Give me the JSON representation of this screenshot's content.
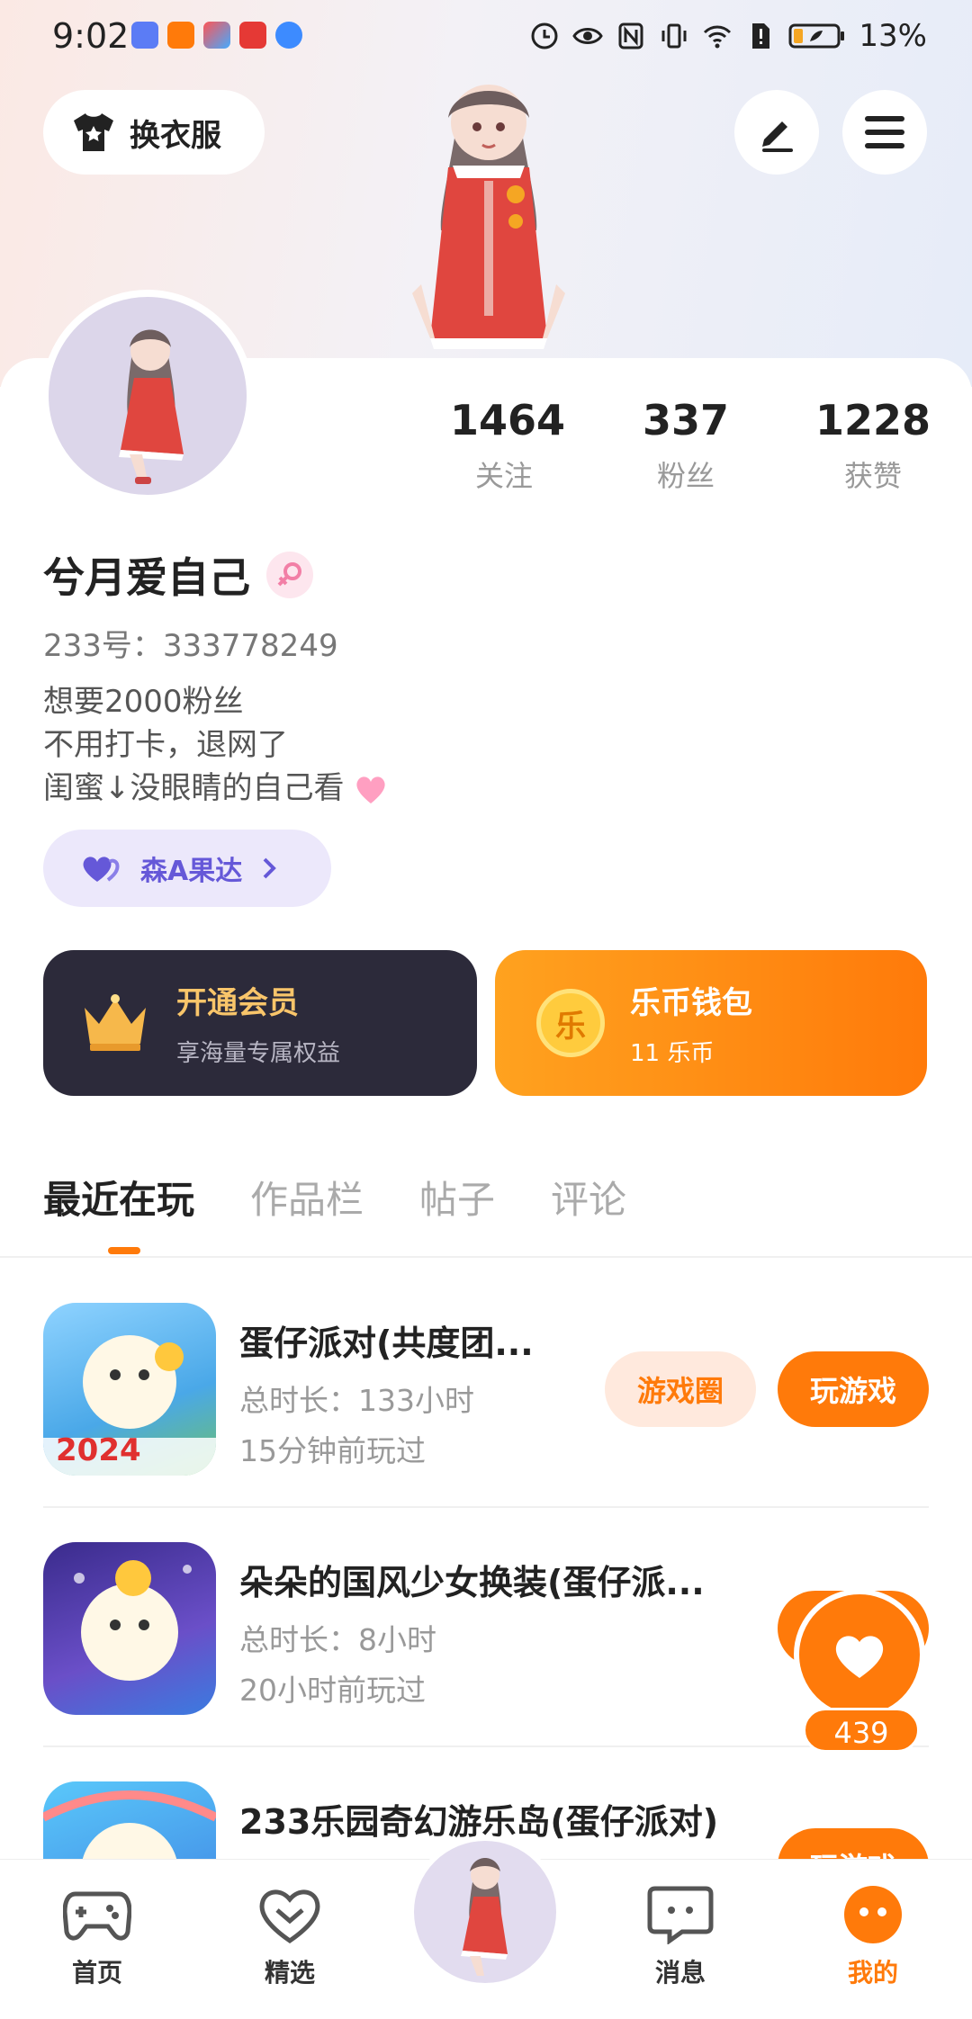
{
  "status_bar": {
    "time": "9:02",
    "battery": "13%"
  },
  "header": {
    "dress_button": "换衣服"
  },
  "stats": [
    {
      "num": "1464",
      "label": "关注"
    },
    {
      "num": "337",
      "label": "粉丝"
    },
    {
      "num": "1228",
      "label": "获赞"
    }
  ],
  "profile": {
    "name": "兮月爱自己",
    "uid": "233号：333778249",
    "bio": [
      "想要2000粉丝",
      "不用打卡，退网了",
      "闺蜜↓没眼睛的自己看"
    ],
    "tag": "森A果达"
  },
  "vip": {
    "title": "开通会员",
    "sub": "享海量专属权益"
  },
  "wallet": {
    "title": "乐币钱包",
    "sub": "11 乐币",
    "coin_char": "乐"
  },
  "tabs": [
    "最近在玩",
    "作品栏",
    "帖子",
    "评论"
  ],
  "games": [
    {
      "title": "蛋仔派对(共度团...",
      "duration": "总时长：133小时",
      "last": "15分钟前玩过",
      "badge": "2024"
    },
    {
      "title": "朵朵的国风少女换装(蛋仔派...",
      "duration": "总时长：8小时",
      "last": "20小时前玩过"
    },
    {
      "title": "233乐园奇幻游乐岛(蛋仔派对)"
    }
  ],
  "buttons": {
    "circle": "游戏圈",
    "play": "玩游戏"
  },
  "likes": "439",
  "nav": [
    {
      "label": "首页"
    },
    {
      "label": "精选"
    },
    {
      "label": "消息"
    },
    {
      "label": "我的"
    }
  ],
  "colors": {
    "accent": "#ff7a0a",
    "vip_bg": "#2c2a3a",
    "tag_bg": "#ece8fb",
    "tag_text": "#6558d8"
  }
}
